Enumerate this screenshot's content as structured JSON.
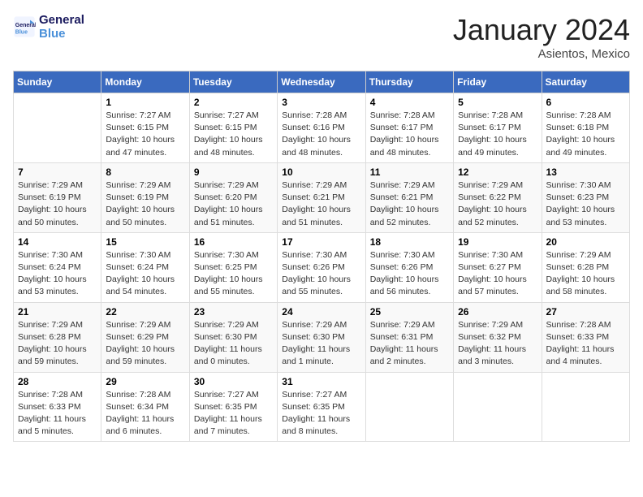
{
  "header": {
    "logo_line1": "General",
    "logo_line2": "Blue",
    "month_title": "January 2024",
    "location": "Asientos, Mexico"
  },
  "days_of_week": [
    "Sunday",
    "Monday",
    "Tuesday",
    "Wednesday",
    "Thursday",
    "Friday",
    "Saturday"
  ],
  "weeks": [
    [
      {
        "num": "",
        "info": ""
      },
      {
        "num": "1",
        "info": "Sunrise: 7:27 AM\nSunset: 6:15 PM\nDaylight: 10 hours\nand 47 minutes."
      },
      {
        "num": "2",
        "info": "Sunrise: 7:27 AM\nSunset: 6:15 PM\nDaylight: 10 hours\nand 48 minutes."
      },
      {
        "num": "3",
        "info": "Sunrise: 7:28 AM\nSunset: 6:16 PM\nDaylight: 10 hours\nand 48 minutes."
      },
      {
        "num": "4",
        "info": "Sunrise: 7:28 AM\nSunset: 6:17 PM\nDaylight: 10 hours\nand 48 minutes."
      },
      {
        "num": "5",
        "info": "Sunrise: 7:28 AM\nSunset: 6:17 PM\nDaylight: 10 hours\nand 49 minutes."
      },
      {
        "num": "6",
        "info": "Sunrise: 7:28 AM\nSunset: 6:18 PM\nDaylight: 10 hours\nand 49 minutes."
      }
    ],
    [
      {
        "num": "7",
        "info": "Sunrise: 7:29 AM\nSunset: 6:19 PM\nDaylight: 10 hours\nand 50 minutes."
      },
      {
        "num": "8",
        "info": "Sunrise: 7:29 AM\nSunset: 6:19 PM\nDaylight: 10 hours\nand 50 minutes."
      },
      {
        "num": "9",
        "info": "Sunrise: 7:29 AM\nSunset: 6:20 PM\nDaylight: 10 hours\nand 51 minutes."
      },
      {
        "num": "10",
        "info": "Sunrise: 7:29 AM\nSunset: 6:21 PM\nDaylight: 10 hours\nand 51 minutes."
      },
      {
        "num": "11",
        "info": "Sunrise: 7:29 AM\nSunset: 6:21 PM\nDaylight: 10 hours\nand 52 minutes."
      },
      {
        "num": "12",
        "info": "Sunrise: 7:29 AM\nSunset: 6:22 PM\nDaylight: 10 hours\nand 52 minutes."
      },
      {
        "num": "13",
        "info": "Sunrise: 7:30 AM\nSunset: 6:23 PM\nDaylight: 10 hours\nand 53 minutes."
      }
    ],
    [
      {
        "num": "14",
        "info": "Sunrise: 7:30 AM\nSunset: 6:24 PM\nDaylight: 10 hours\nand 53 minutes."
      },
      {
        "num": "15",
        "info": "Sunrise: 7:30 AM\nSunset: 6:24 PM\nDaylight: 10 hours\nand 54 minutes."
      },
      {
        "num": "16",
        "info": "Sunrise: 7:30 AM\nSunset: 6:25 PM\nDaylight: 10 hours\nand 55 minutes."
      },
      {
        "num": "17",
        "info": "Sunrise: 7:30 AM\nSunset: 6:26 PM\nDaylight: 10 hours\nand 55 minutes."
      },
      {
        "num": "18",
        "info": "Sunrise: 7:30 AM\nSunset: 6:26 PM\nDaylight: 10 hours\nand 56 minutes."
      },
      {
        "num": "19",
        "info": "Sunrise: 7:30 AM\nSunset: 6:27 PM\nDaylight: 10 hours\nand 57 minutes."
      },
      {
        "num": "20",
        "info": "Sunrise: 7:29 AM\nSunset: 6:28 PM\nDaylight: 10 hours\nand 58 minutes."
      }
    ],
    [
      {
        "num": "21",
        "info": "Sunrise: 7:29 AM\nSunset: 6:28 PM\nDaylight: 10 hours\nand 59 minutes."
      },
      {
        "num": "22",
        "info": "Sunrise: 7:29 AM\nSunset: 6:29 PM\nDaylight: 10 hours\nand 59 minutes."
      },
      {
        "num": "23",
        "info": "Sunrise: 7:29 AM\nSunset: 6:30 PM\nDaylight: 11 hours\nand 0 minutes."
      },
      {
        "num": "24",
        "info": "Sunrise: 7:29 AM\nSunset: 6:30 PM\nDaylight: 11 hours\nand 1 minute."
      },
      {
        "num": "25",
        "info": "Sunrise: 7:29 AM\nSunset: 6:31 PM\nDaylight: 11 hours\nand 2 minutes."
      },
      {
        "num": "26",
        "info": "Sunrise: 7:29 AM\nSunset: 6:32 PM\nDaylight: 11 hours\nand 3 minutes."
      },
      {
        "num": "27",
        "info": "Sunrise: 7:28 AM\nSunset: 6:33 PM\nDaylight: 11 hours\nand 4 minutes."
      }
    ],
    [
      {
        "num": "28",
        "info": "Sunrise: 7:28 AM\nSunset: 6:33 PM\nDaylight: 11 hours\nand 5 minutes."
      },
      {
        "num": "29",
        "info": "Sunrise: 7:28 AM\nSunset: 6:34 PM\nDaylight: 11 hours\nand 6 minutes."
      },
      {
        "num": "30",
        "info": "Sunrise: 7:27 AM\nSunset: 6:35 PM\nDaylight: 11 hours\nand 7 minutes."
      },
      {
        "num": "31",
        "info": "Sunrise: 7:27 AM\nSunset: 6:35 PM\nDaylight: 11 hours\nand 8 minutes."
      },
      {
        "num": "",
        "info": ""
      },
      {
        "num": "",
        "info": ""
      },
      {
        "num": "",
        "info": ""
      }
    ]
  ]
}
